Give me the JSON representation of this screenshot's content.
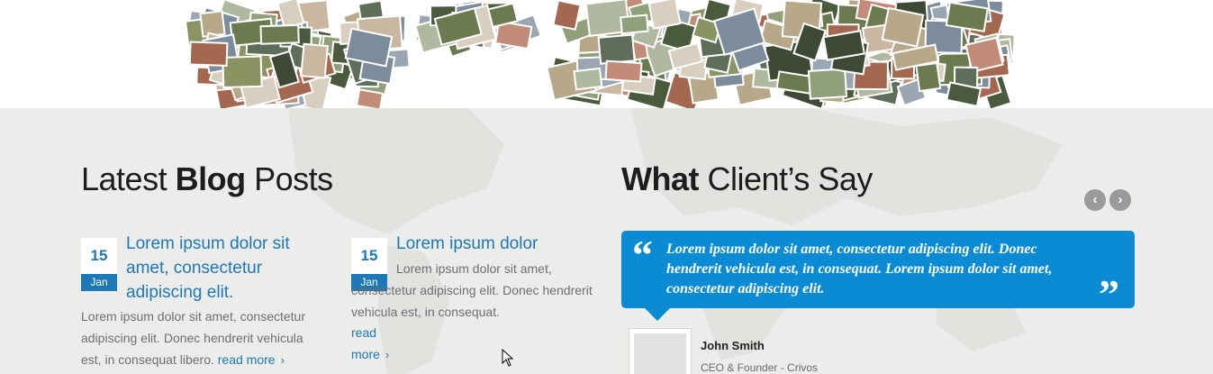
{
  "blog": {
    "title_pre": "Latest ",
    "title_bold": "Blog",
    "title_post": " Posts",
    "posts": [
      {
        "day": "15",
        "month": "Jan",
        "title": "Lorem ipsum dolor sit amet, consectetur adipiscing elit.",
        "excerpt": "Lorem ipsum dolor sit amet, consectetur adipiscing elit. Donec hendrerit vehicula est, in consequat libero.",
        "read_more": "read more"
      },
      {
        "day": "15",
        "month": "Jan",
        "title": "Lorem ipsum dolor",
        "excerpt": "Lorem ipsum dolor sit amet, consectetur adipiscing elit. Donec hendrerit vehicula est, in consequat.",
        "read_more": "read more"
      }
    ]
  },
  "testimonials": {
    "title_bold": "What",
    "title_post": " Client’s Say",
    "quote": "Lorem ipsum dolor sit amet, consectetur adipiscing elit. Donec hendrerit vehicula est, in consequat. Lorem ipsum dolor sit amet, consectetur adipiscing elit.",
    "open_quote_mark": "“",
    "close_quote_mark": "”",
    "author_name": "John Smith",
    "author_role": "CEO & Founder - Crivos",
    "prev_symbol": "‹",
    "next_symbol": "›"
  },
  "colors": {
    "accent": "#1d78b5",
    "quote_bg": "#0a8bd4",
    "section_bg": "#ececea"
  }
}
